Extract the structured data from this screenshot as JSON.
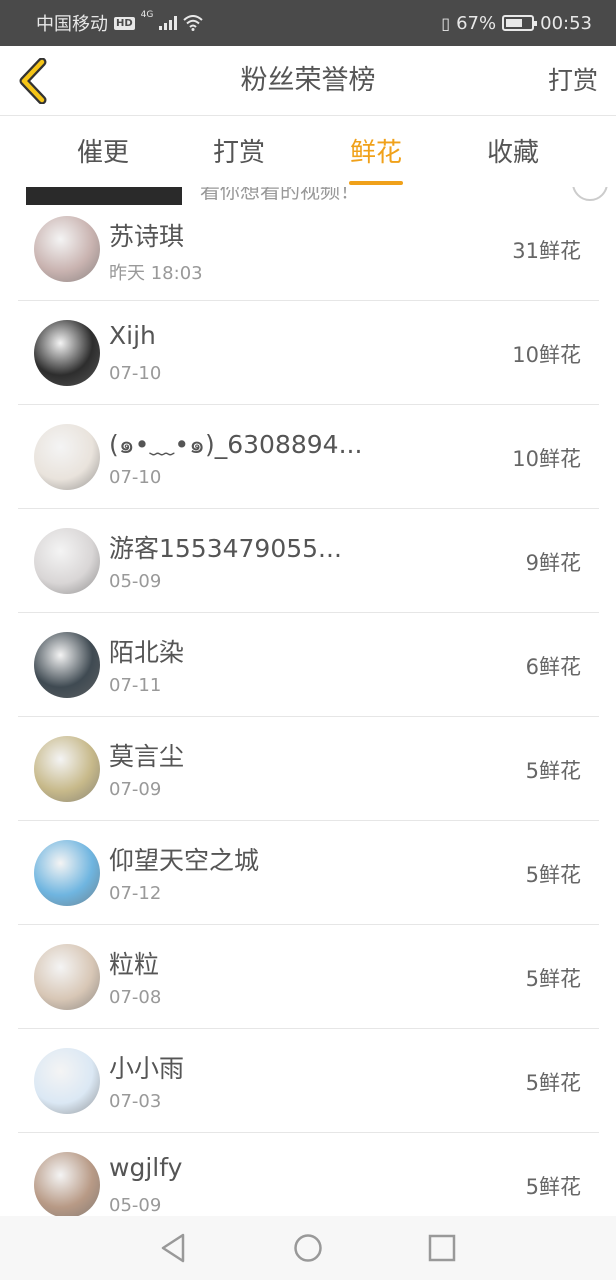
{
  "status_bar": {
    "carrier": "中国移动",
    "hd": "HD",
    "network": "4G",
    "battery_percent": "67%",
    "battery_level": 0.67,
    "time": "00:53"
  },
  "header": {
    "title": "粉丝荣誉榜",
    "action": "打赏",
    "back_icon": "chevron-left-icon"
  },
  "tabs": [
    {
      "label": "催更",
      "active": false
    },
    {
      "label": "打赏",
      "active": false
    },
    {
      "label": "鲜花",
      "active": true
    },
    {
      "label": "收藏",
      "active": false
    }
  ],
  "ad": {
    "text": "看你想看的视频！"
  },
  "entries": [
    {
      "name": "苏诗琪",
      "date": "昨天 18:03",
      "amount": "31鲜花",
      "avatar_color": "#c9b3b0"
    },
    {
      "name": "Xijh",
      "date": "07-10",
      "amount": "10鲜花",
      "avatar_color": "#2d2d2d"
    },
    {
      "name": "(๑•﹏•๑)_6308894...",
      "date": "07-10",
      "amount": "10鲜花",
      "avatar_color": "#e9e3dc"
    },
    {
      "name": "游客1553479055...",
      "date": "05-09",
      "amount": "9鲜花",
      "avatar_color": "#d9d6d6"
    },
    {
      "name": "陌北染",
      "date": "07-11",
      "amount": "6鲜花",
      "avatar_color": "#3f4a52"
    },
    {
      "name": "莫言尘",
      "date": "07-09",
      "amount": "5鲜花",
      "avatar_color": "#c7b98a"
    },
    {
      "name": "仰望天空之城",
      "date": "07-12",
      "amount": "5鲜花",
      "avatar_color": "#6fb5e0"
    },
    {
      "name": "粒粒",
      "date": "07-08",
      "amount": "5鲜花",
      "avatar_color": "#d8c7b6"
    },
    {
      "name": "小小雨",
      "date": "07-03",
      "amount": "5鲜花",
      "avatar_color": "#dbe8f4"
    },
    {
      "name": "wgjlfy",
      "date": "05-09",
      "amount": "5鲜花",
      "avatar_color": "#b89a86"
    }
  ],
  "nav": {
    "back_icon": "triangle-back-icon",
    "home_icon": "circle-home-icon",
    "recent_icon": "square-recent-icon"
  },
  "colors": {
    "accent": "#f0a11a",
    "status_bar": "#4a4a4a"
  }
}
